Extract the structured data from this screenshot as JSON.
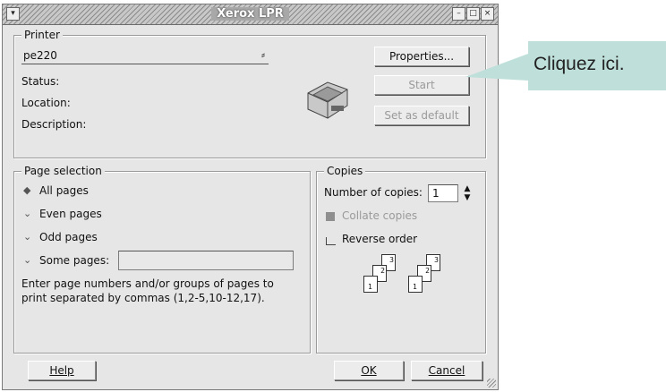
{
  "window": {
    "title": "Xerox LPR"
  },
  "printer": {
    "legend": "Printer",
    "selected": "pe220",
    "status_label": "Status:",
    "location_label": "Location:",
    "description_label": "Description:",
    "properties_button": "Properties...",
    "start_button": "Start",
    "set_default_button": "Set as default"
  },
  "page_selection": {
    "legend": "Page selection",
    "options": [
      {
        "label": "All pages",
        "selected": true
      },
      {
        "label": "Even pages",
        "selected": false
      },
      {
        "label": "Odd pages",
        "selected": false
      },
      {
        "label": "Some pages:",
        "selected": false
      }
    ],
    "hint_line1": "Enter page numbers and/or groups of pages to",
    "hint_line2": "print separated by commas (1,2-5,10-12,17)."
  },
  "copies": {
    "legend": "Copies",
    "number_label": "Number of copies:",
    "number_value": "1",
    "collate_label": "Collate copies",
    "reverse_label": "Reverse order",
    "stack_labels": [
      "3",
      "2",
      "1"
    ]
  },
  "buttons": {
    "help": "Help",
    "ok": "OK",
    "cancel": "Cancel"
  },
  "callout": {
    "text": "Cliquez ici."
  }
}
